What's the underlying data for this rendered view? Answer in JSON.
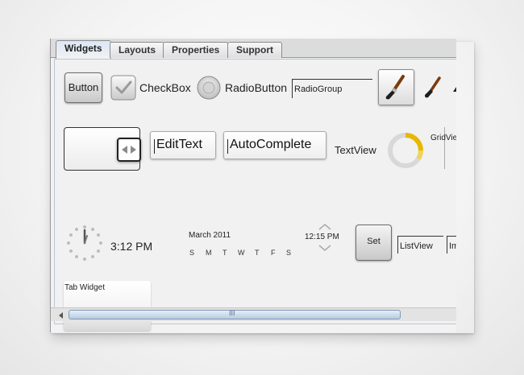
{
  "tabs": [
    {
      "label": "Widgets"
    },
    {
      "label": "Layouts"
    },
    {
      "label": "Properties"
    },
    {
      "label": "Support"
    }
  ],
  "widgets": {
    "button_label": "Button",
    "checkbox_label": "CheckBox",
    "radiobutton_label": "RadioButton",
    "radiogroup_label": "RadioGroup",
    "edittext_label": "EditText",
    "autocomplete_label": "AutoComplete",
    "textview_label": "TextView",
    "gridview_label": "GridVie",
    "digital_clock": "3:12 PM",
    "date_picker": {
      "month": "March 2011",
      "days": [
        "S",
        "M",
        "T",
        "W",
        "T",
        "F",
        "S"
      ]
    },
    "time_picker": "12:15 PM",
    "set_button": "Set",
    "listview_label": "ListView",
    "imageview_label": "Im",
    "tabwidget_label": "Tab Widget"
  },
  "scrollbar": {
    "thumb_grip": "III"
  },
  "colors": {
    "accent": "#e8b800",
    "tab_active": "#dbe7f7",
    "frame_border": "#7d9bc0"
  }
}
